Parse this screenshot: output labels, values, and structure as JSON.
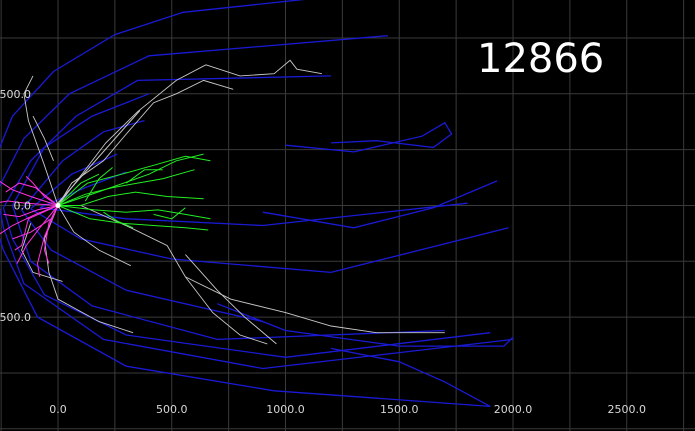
{
  "chart_data": {
    "type": "line",
    "title": "",
    "counter_label": "12866",
    "xlabel": "",
    "ylabel": "",
    "xlim": [
      -255,
      2800
    ],
    "ylim": [
      -1010,
      920
    ],
    "grid": true,
    "x_ticks": [
      0,
      500,
      1000,
      1500,
      2000,
      2500
    ],
    "x_tick_labels": [
      "0.0",
      "500.0",
      "1000.0",
      "1500.0",
      "2000.0",
      "2500.0"
    ],
    "y_ticks": [
      500,
      0,
      -500
    ],
    "y_tick_labels": [
      "500.0",
      "0.0",
      "500.0"
    ],
    "colors": {
      "background": "#000000",
      "grid": "#3a3a3a",
      "contour": "#1a1ad6",
      "dendrite_gray": "#c8c8c8",
      "dendrite_green": "#22ee22",
      "dendrite_magenta": "#ff33dd",
      "soma": "#ffffff"
    },
    "contours": [
      [
        [
          -300,
          150
        ],
        [
          -200,
          400
        ],
        [
          -20,
          600
        ],
        [
          250,
          765
        ],
        [
          550,
          865
        ],
        [
          1150,
          930
        ]
      ],
      [
        [
          -270,
          60
        ],
        [
          -150,
          300
        ],
        [
          50,
          500
        ],
        [
          400,
          670
        ],
        [
          1450,
          760
        ]
      ],
      [
        [
          -240,
          -10
        ],
        [
          -120,
          200
        ],
        [
          80,
          400
        ],
        [
          350,
          560
        ],
        [
          1200,
          580
        ]
      ],
      [
        [
          -200,
          0
        ],
        [
          -60,
          260
        ],
        [
          150,
          400
        ],
        [
          400,
          500
        ]
      ],
      [
        [
          -160,
          -20
        ],
        [
          20,
          200
        ],
        [
          200,
          330
        ],
        [
          380,
          380
        ]
      ],
      [
        [
          -120,
          -15
        ],
        [
          60,
          140
        ],
        [
          260,
          230
        ]
      ],
      [
        [
          -80,
          -10
        ],
        [
          120,
          80
        ],
        [
          300,
          150
        ]
      ],
      [
        [
          -300,
          150
        ],
        [
          -310,
          20
        ],
        [
          -240,
          -200
        ],
        [
          -90,
          -500
        ],
        [
          300,
          -720
        ],
        [
          950,
          -830
        ],
        [
          1900,
          -900
        ]
      ],
      [
        [
          -270,
          60
        ],
        [
          -240,
          -100
        ],
        [
          -150,
          -350
        ],
        [
          200,
          -600
        ],
        [
          900,
          -730
        ],
        [
          2000,
          -600
        ]
      ],
      [
        [
          -240,
          -10
        ],
        [
          -200,
          -150
        ],
        [
          -60,
          -400
        ],
        [
          300,
          -580
        ],
        [
          1000,
          -680
        ],
        [
          1900,
          -570
        ]
      ],
      [
        [
          -200,
          0
        ],
        [
          -120,
          -250
        ],
        [
          150,
          -450
        ],
        [
          700,
          -600
        ],
        [
          1700,
          -560
        ]
      ],
      [
        [
          -160,
          -20
        ],
        [
          -30,
          -200
        ],
        [
          300,
          -380
        ],
        [
          900,
          -520
        ]
      ],
      [
        [
          -120,
          -15
        ],
        [
          100,
          -150
        ],
        [
          500,
          -240
        ],
        [
          1200,
          -300
        ],
        [
          1980,
          -100
        ]
      ],
      [
        [
          -80,
          -10
        ],
        [
          300,
          -60
        ],
        [
          900,
          -90
        ],
        [
          1800,
          10
        ]
      ],
      [
        [
          700,
          -440
        ],
        [
          1000,
          -560
        ],
        [
          1500,
          -630
        ],
        [
          1960,
          -630
        ],
        [
          2000,
          -590
        ]
      ],
      [
        [
          1900,
          -900
        ],
        [
          1700,
          -790
        ],
        [
          1500,
          -700
        ],
        [
          1200,
          -640
        ]
      ],
      [
        [
          1000,
          270
        ],
        [
          1300,
          240
        ],
        [
          1600,
          310
        ],
        [
          1700,
          370
        ],
        [
          1730,
          320
        ],
        [
          1650,
          260
        ],
        [
          1400,
          290
        ],
        [
          1200,
          280
        ]
      ],
      [
        [
          900,
          -30
        ],
        [
          1300,
          -100
        ],
        [
          1650,
          -10
        ],
        [
          1930,
          110
        ]
      ]
    ],
    "dendrites_gray": [
      [
        [
          0,
          0
        ],
        [
          -60,
          180
        ],
        [
          -130,
          380
        ],
        [
          -150,
          500
        ],
        [
          -110,
          580
        ]
      ],
      [
        [
          0,
          0
        ],
        [
          -60,
          -150
        ],
        [
          -40,
          -300
        ],
        [
          0,
          -420
        ],
        [
          180,
          -520
        ],
        [
          330,
          -570
        ]
      ],
      [
        [
          0,
          0
        ],
        [
          70,
          -120
        ],
        [
          180,
          -200
        ],
        [
          320,
          -270
        ]
      ],
      [
        [
          0,
          0
        ],
        [
          60,
          100
        ],
        [
          200,
          200
        ],
        [
          300,
          320
        ],
        [
          420,
          460
        ],
        [
          520,
          500
        ],
        [
          640,
          560
        ],
        [
          770,
          520
        ]
      ],
      [
        [
          0,
          0
        ],
        [
          210,
          280
        ],
        [
          350,
          420
        ],
        [
          520,
          560
        ],
        [
          650,
          630
        ]
      ],
      [
        [
          650,
          630
        ],
        [
          800,
          580
        ],
        [
          950,
          590
        ],
        [
          1020,
          650
        ],
        [
          1050,
          610
        ],
        [
          1160,
          590
        ]
      ],
      [
        [
          100,
          0
        ],
        [
          320,
          -100
        ],
        [
          480,
          -180
        ],
        [
          560,
          -320
        ],
        [
          680,
          -480
        ],
        [
          800,
          -580
        ],
        [
          920,
          -620
        ]
      ],
      [
        [
          560,
          -320
        ],
        [
          760,
          -420
        ],
        [
          1000,
          -480
        ],
        [
          1200,
          -540
        ],
        [
          1400,
          -570
        ],
        [
          1700,
          -570
        ]
      ],
      [
        [
          560,
          -220
        ],
        [
          700,
          -380
        ],
        [
          820,
          -500
        ],
        [
          960,
          -620
        ]
      ],
      [
        [
          -120,
          -80
        ],
        [
          -160,
          -200
        ],
        [
          -110,
          -300
        ],
        [
          20,
          -340
        ]
      ],
      [
        [
          -110,
          400
        ],
        [
          -60,
          300
        ],
        [
          -20,
          200
        ]
      ]
    ],
    "dendrites_green": [
      [
        [
          0,
          0
        ],
        [
          120,
          40
        ],
        [
          260,
          90
        ],
        [
          400,
          140
        ],
        [
          520,
          200
        ],
        [
          640,
          230
        ]
      ],
      [
        [
          0,
          0
        ],
        [
          130,
          100
        ],
        [
          280,
          140
        ],
        [
          420,
          180
        ],
        [
          560,
          220
        ],
        [
          670,
          200
        ]
      ],
      [
        [
          0,
          0
        ],
        [
          160,
          -20
        ],
        [
          300,
          -30
        ],
        [
          440,
          -20
        ],
        [
          560,
          -40
        ],
        [
          670,
          -60
        ]
      ],
      [
        [
          0,
          0
        ],
        [
          140,
          -60
        ],
        [
          280,
          -80
        ],
        [
          420,
          -90
        ],
        [
          560,
          -100
        ],
        [
          660,
          -110
        ]
      ],
      [
        [
          0,
          0
        ],
        [
          120,
          50
        ],
        [
          240,
          80
        ],
        [
          350,
          100
        ],
        [
          460,
          120
        ],
        [
          600,
          160
        ]
      ],
      [
        [
          0,
          0
        ],
        [
          100,
          0
        ],
        [
          220,
          40
        ],
        [
          340,
          60
        ],
        [
          480,
          40
        ],
        [
          640,
          30
        ]
      ],
      [
        [
          120,
          20
        ],
        [
          180,
          120
        ],
        [
          240,
          170
        ]
      ],
      [
        [
          200,
          -30
        ],
        [
          260,
          -70
        ],
        [
          330,
          -100
        ]
      ],
      [
        [
          0,
          0
        ],
        [
          100,
          100
        ],
        [
          180,
          140
        ]
      ],
      [
        [
          300,
          100
        ],
        [
          380,
          160
        ],
        [
          460,
          160
        ]
      ],
      [
        [
          420,
          -40
        ],
        [
          500,
          -60
        ],
        [
          560,
          -10
        ]
      ]
    ],
    "dendrites_magenta": [
      [
        [
          0,
          0
        ],
        [
          -120,
          40
        ],
        [
          -200,
          70
        ],
        [
          -260,
          110
        ]
      ],
      [
        [
          0,
          0
        ],
        [
          -100,
          -40
        ],
        [
          -200,
          -90
        ],
        [
          -260,
          -130
        ]
      ],
      [
        [
          0,
          0
        ],
        [
          -80,
          -100
        ],
        [
          -140,
          -180
        ],
        [
          -180,
          -260
        ]
      ],
      [
        [
          0,
          0
        ],
        [
          -60,
          -140
        ],
        [
          -90,
          -260
        ],
        [
          -80,
          -320
        ]
      ],
      [
        [
          0,
          0
        ],
        [
          -140,
          10
        ],
        [
          -220,
          20
        ],
        [
          -280,
          10
        ]
      ],
      [
        [
          0,
          0
        ],
        [
          -100,
          80
        ],
        [
          -170,
          100
        ],
        [
          -230,
          60
        ]
      ],
      [
        [
          0,
          0
        ],
        [
          -60,
          40
        ],
        [
          -110,
          100
        ],
        [
          -140,
          130
        ]
      ],
      [
        [
          0,
          0
        ],
        [
          -130,
          -60
        ],
        [
          -160,
          -180
        ],
        [
          -190,
          -200
        ]
      ],
      [
        [
          0,
          0
        ],
        [
          -40,
          -80
        ],
        [
          -60,
          -200
        ],
        [
          -40,
          -260
        ]
      ],
      [
        [
          0,
          0
        ],
        [
          -90,
          -20
        ],
        [
          -170,
          -50
        ],
        [
          -240,
          -40
        ]
      ],
      [
        [
          0,
          0
        ],
        [
          -30,
          -60
        ],
        [
          -120,
          -120
        ],
        [
          -200,
          -150
        ]
      ]
    ],
    "axon": [
      [
        -10,
        0
      ],
      [
        360,
        425
      ]
    ],
    "soma": [
      0,
      0
    ]
  }
}
